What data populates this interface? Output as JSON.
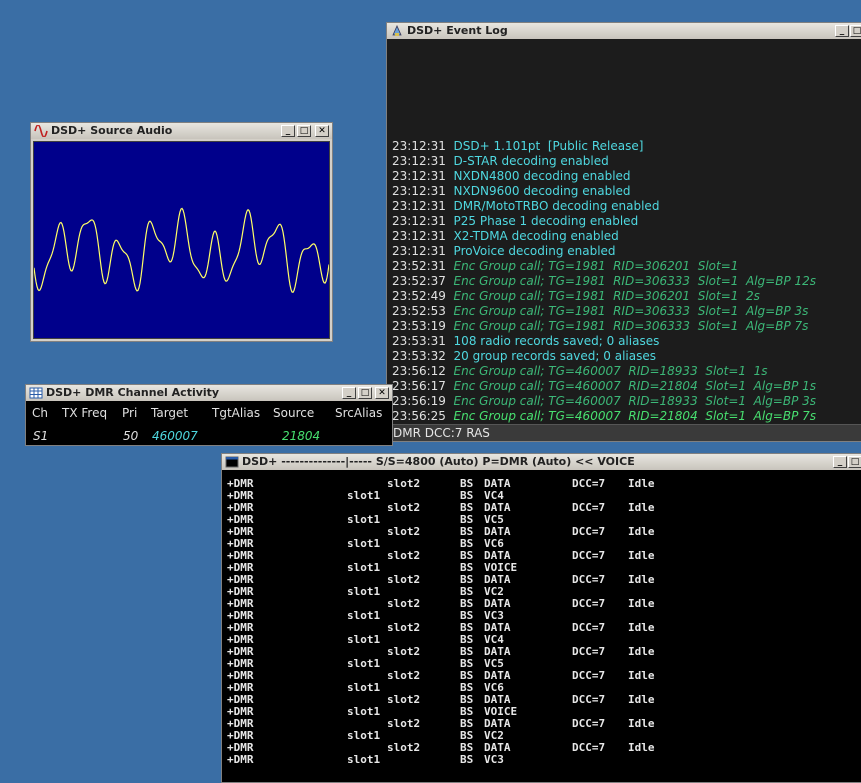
{
  "event_log": {
    "title": "DSD+ Event Log",
    "lines": [
      {
        "time": "23:12:31",
        "msg": "DSD+ 1.101pt  [Public Release]",
        "style": "cyan"
      },
      {
        "time": "23:12:31",
        "msg": "D-STAR decoding enabled",
        "style": "cyan"
      },
      {
        "time": "23:12:31",
        "msg": "NXDN4800 decoding enabled",
        "style": "cyan"
      },
      {
        "time": "23:12:31",
        "msg": "NXDN9600 decoding enabled",
        "style": "cyan"
      },
      {
        "time": "23:12:31",
        "msg": "DMR/MotoTRBO decoding enabled",
        "style": "cyan"
      },
      {
        "time": "23:12:31",
        "msg": "P25 Phase 1 decoding enabled",
        "style": "cyan"
      },
      {
        "time": "23:12:31",
        "msg": "X2-TDMA decoding enabled",
        "style": "cyan"
      },
      {
        "time": "23:12:31",
        "msg": "ProVoice decoding enabled",
        "style": "cyan"
      },
      {
        "time": "23:52:31",
        "msg": "Enc Group call; TG=1981  RID=306201  Slot=1",
        "style": "green"
      },
      {
        "time": "23:52:37",
        "msg": "Enc Group call; TG=1981  RID=306333  Slot=1  Alg=BP 12s",
        "style": "green"
      },
      {
        "time": "23:52:49",
        "msg": "Enc Group call; TG=1981  RID=306201  Slot=1  2s",
        "style": "green"
      },
      {
        "time": "23:52:53",
        "msg": "Enc Group call; TG=1981  RID=306333  Slot=1  Alg=BP 3s",
        "style": "green"
      },
      {
        "time": "23:53:19",
        "msg": "Enc Group call; TG=1981  RID=306333  Slot=1  Alg=BP 7s",
        "style": "green"
      },
      {
        "time": "23:53:31",
        "msg": "108 radio records saved; 0 aliases",
        "style": "cyan"
      },
      {
        "time": "23:53:32",
        "msg": "20 group records saved; 0 aliases",
        "style": "cyan"
      },
      {
        "time": "23:56:12",
        "msg": "Enc Group call; TG=460007  RID=18933  Slot=1  1s",
        "style": "green"
      },
      {
        "time": "23:56:17",
        "msg": "Enc Group call; TG=460007  RID=21804  Slot=1  Alg=BP 1s",
        "style": "green"
      },
      {
        "time": "23:56:19",
        "msg": "Enc Group call; TG=460007  RID=18933  Slot=1  Alg=BP 3s",
        "style": "green"
      },
      {
        "time": "23:56:25",
        "msg": "Enc Group call; TG=460007  RID=21804  Slot=1  Alg=BP 7s",
        "style": "bright"
      }
    ],
    "status": "DMR  DCC:7  RAS"
  },
  "source_audio": {
    "title": "DSD+ Source Audio"
  },
  "channel_activity": {
    "title": "DSD+ DMR Channel Activity",
    "headers": {
      "ch": "Ch",
      "txfreq": "TX Freq",
      "pri": "Pri",
      "target": "Target",
      "tgtalias": "TgtAlias",
      "source": "Source",
      "srcalias": "SrcAlias"
    },
    "row": {
      "ch": "S1",
      "txfreq": "",
      "pri": "50",
      "target": "460007",
      "tgtalias": "",
      "source": "21804",
      "srcalias": ""
    }
  },
  "terminal": {
    "title": "DSD+  --------------|----- S/S=4800 (Auto) P=DMR (Auto)   << VOICE",
    "rows": [
      {
        "proto": "+DMR",
        "slot": "slot2",
        "bs": "BS",
        "type": "DATA",
        "dcc": "DCC=7",
        "state": "Idle"
      },
      {
        "proto": "+DMR",
        "slot": "slot1",
        "bs": "BS",
        "type": "VC4",
        "dcc": "",
        "state": ""
      },
      {
        "proto": "+DMR",
        "slot": "slot2",
        "bs": "BS",
        "type": "DATA",
        "dcc": "DCC=7",
        "state": "Idle"
      },
      {
        "proto": "+DMR",
        "slot": "slot1",
        "bs": "BS",
        "type": "VC5",
        "dcc": "",
        "state": ""
      },
      {
        "proto": "+DMR",
        "slot": "slot2",
        "bs": "BS",
        "type": "DATA",
        "dcc": "DCC=7",
        "state": "Idle"
      },
      {
        "proto": "+DMR",
        "slot": "slot1",
        "bs": "BS",
        "type": "VC6",
        "dcc": "",
        "state": ""
      },
      {
        "proto": "+DMR",
        "slot": "slot2",
        "bs": "BS",
        "type": "DATA",
        "dcc": "DCC=7",
        "state": "Idle"
      },
      {
        "proto": "+DMR",
        "slot": "slot1",
        "bs": "BS",
        "type": "VOICE",
        "dcc": "",
        "state": ""
      },
      {
        "proto": "+DMR",
        "slot": "slot2",
        "bs": "BS",
        "type": "DATA",
        "dcc": "DCC=7",
        "state": "Idle"
      },
      {
        "proto": "+DMR",
        "slot": "slot1",
        "bs": "BS",
        "type": "VC2",
        "dcc": "",
        "state": ""
      },
      {
        "proto": "+DMR",
        "slot": "slot2",
        "bs": "BS",
        "type": "DATA",
        "dcc": "DCC=7",
        "state": "Idle"
      },
      {
        "proto": "+DMR",
        "slot": "slot1",
        "bs": "BS",
        "type": "VC3",
        "dcc": "",
        "state": ""
      },
      {
        "proto": "+DMR",
        "slot": "slot2",
        "bs": "BS",
        "type": "DATA",
        "dcc": "DCC=7",
        "state": "Idle"
      },
      {
        "proto": "+DMR",
        "slot": "slot1",
        "bs": "BS",
        "type": "VC4",
        "dcc": "",
        "state": ""
      },
      {
        "proto": "+DMR",
        "slot": "slot2",
        "bs": "BS",
        "type": "DATA",
        "dcc": "DCC=7",
        "state": "Idle"
      },
      {
        "proto": "+DMR",
        "slot": "slot1",
        "bs": "BS",
        "type": "VC5",
        "dcc": "",
        "state": ""
      },
      {
        "proto": "+DMR",
        "slot": "slot2",
        "bs": "BS",
        "type": "DATA",
        "dcc": "DCC=7",
        "state": "Idle"
      },
      {
        "proto": "+DMR",
        "slot": "slot1",
        "bs": "BS",
        "type": "VC6",
        "dcc": "",
        "state": ""
      },
      {
        "proto": "+DMR",
        "slot": "slot2",
        "bs": "BS",
        "type": "DATA",
        "dcc": "DCC=7",
        "state": "Idle"
      },
      {
        "proto": "+DMR",
        "slot": "slot1",
        "bs": "BS",
        "type": "VOICE",
        "dcc": "",
        "state": ""
      },
      {
        "proto": "+DMR",
        "slot": "slot2",
        "bs": "BS",
        "type": "DATA",
        "dcc": "DCC=7",
        "state": "Idle"
      },
      {
        "proto": "+DMR",
        "slot": "slot1",
        "bs": "BS",
        "type": "VC2",
        "dcc": "",
        "state": ""
      },
      {
        "proto": "+DMR",
        "slot": "slot2",
        "bs": "BS",
        "type": "DATA",
        "dcc": "DCC=7",
        "state": "Idle"
      },
      {
        "proto": "+DMR",
        "slot": "slot1",
        "bs": "BS",
        "type": "VC3",
        "dcc": "",
        "state": ""
      }
    ]
  },
  "window_buttons": {
    "minimize": "_",
    "maximize": "□",
    "close": "✕"
  },
  "colors": {
    "desktop": "#3a6ea5",
    "cyan": "#4fd8e0",
    "green": "#3cb878",
    "bright_green": "#48e070",
    "scope_bg": "#00008b",
    "waveform": "#ffff66"
  },
  "icons": [
    "sine-wave-icon",
    "grid-icon",
    "window-icon",
    "event-log-icon"
  ]
}
